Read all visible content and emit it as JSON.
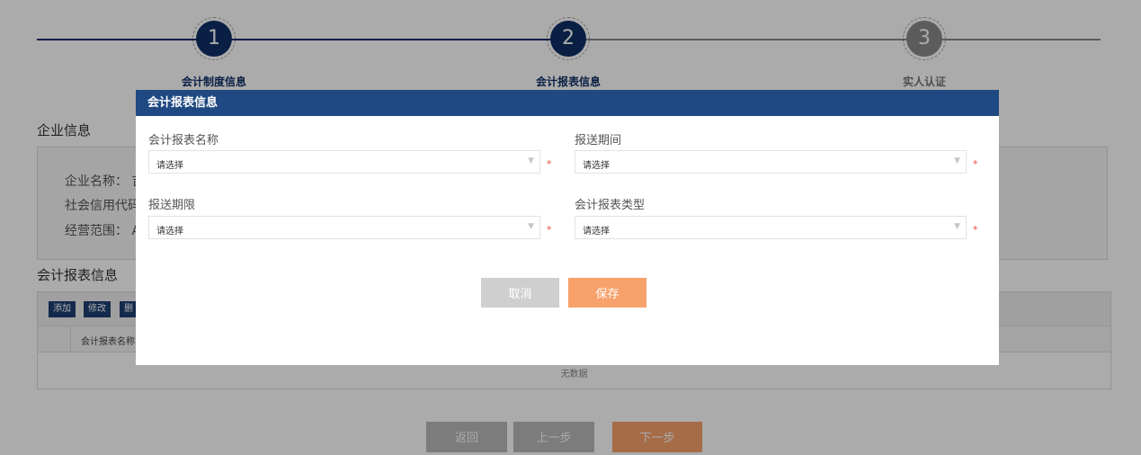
{
  "colors": {
    "primary": "#1f4982",
    "step_dark": "#0f2f66",
    "step_inactive": "#8a8a8a",
    "accent_orange": "#f7a16b",
    "cancel_gray": "#cfcfcf",
    "required_red": "#e74c3c"
  },
  "stepper": {
    "steps": [
      {
        "number": "1",
        "label": "会计制度信息",
        "state": "complete"
      },
      {
        "number": "2",
        "label": "会计报表信息",
        "state": "active"
      },
      {
        "number": "3",
        "label": "实人认证",
        "state": "inactive"
      }
    ]
  },
  "company_section": {
    "title": "企业信息",
    "fields": [
      {
        "label": "企业名称：",
        "value": "吉"
      },
      {
        "label": "社会信用代码",
        "value": ""
      },
      {
        "label": "经营范围：",
        "value": "A"
      }
    ]
  },
  "report_section": {
    "title": "会计报表信息",
    "toolbar": {
      "add": "添加",
      "edit": "修改",
      "delete": "删"
    },
    "columns": [
      "会计报表名称"
    ],
    "empty_text": "无数据"
  },
  "bottom_buttons": {
    "back": "返回",
    "prev": "上一步",
    "next": "下一步"
  },
  "modal": {
    "title": "会计报表信息",
    "fields": {
      "report_name": {
        "label": "会计报表名称",
        "value": "请选择",
        "icon": "chevron-down-icon"
      },
      "submit_period": {
        "label": "报送期间",
        "value": "请选择",
        "icon": "chevron-down-icon"
      },
      "submit_deadline": {
        "label": "报送期限",
        "value": "请选择",
        "icon": "chevron-down-icon"
      },
      "report_type": {
        "label": "会计报表类型",
        "value": "请选择",
        "icon": "chevron-down-icon"
      }
    },
    "required_mark": "*",
    "buttons": {
      "cancel": "取消",
      "save": "保存"
    }
  }
}
